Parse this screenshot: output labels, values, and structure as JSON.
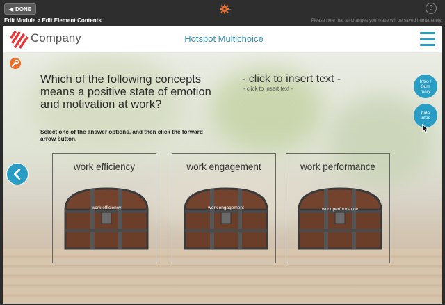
{
  "toolbar": {
    "done_label": "DONE",
    "help_label": "?"
  },
  "breadcrumb": "Edit Module > Edit Element Contents",
  "notice": "Please note that all changes you make will be saved immediately.",
  "header": {
    "company": "Company",
    "title": "Hotspot Multichoice"
  },
  "content": {
    "question": "Which of the following concepts means a positive state of emotion and motivation at work?",
    "instruction": "Select one of the answer options, and then click the forward arrow button.",
    "insert_big": "- click to insert text -",
    "insert_small": "- click to insert text -"
  },
  "side_buttons": {
    "intro_summary": "Intro / Sum mary",
    "hide_infos": "hide infos"
  },
  "options": [
    {
      "label": "work efficiency",
      "chest_label": "work efficiency"
    },
    {
      "label": "work engagement",
      "chest_label": "work engagement"
    },
    {
      "label": "work performance",
      "chest_label": "work performance"
    }
  ],
  "colors": {
    "accent": "#2a9dc4",
    "gear": "#e8702a",
    "logo": "#e23a3a"
  },
  "icons": {
    "back": "left-arrow-icon",
    "menu": "hamburger-icon",
    "settings": "gear-icon",
    "edit": "wrench-icon"
  }
}
